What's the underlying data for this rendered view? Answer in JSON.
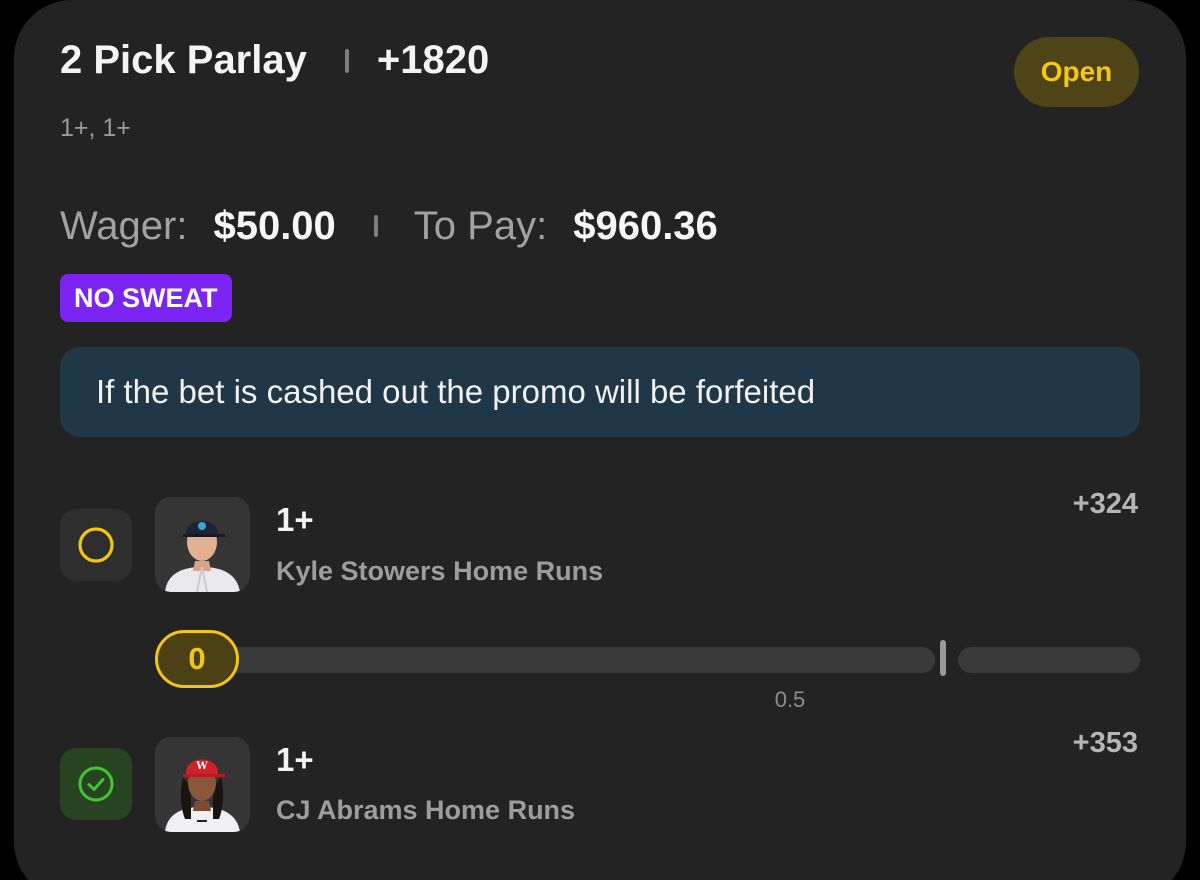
{
  "bet": {
    "title": "2 Pick Parlay",
    "odds": "+1820",
    "status": "Open",
    "subtitle": "1+, 1+",
    "wager_label": "Wager:",
    "wager_value": "$50.00",
    "topay_label": "To Pay:",
    "topay_value": "$960.36",
    "promo_badge": "NO SWEAT",
    "notice": "If the bet is cashed out the promo will be forfeited"
  },
  "picks": [
    {
      "line": "1+",
      "market": "Kyle Stowers Home Runs",
      "odds": "+324",
      "status": "pending",
      "progress": {
        "current": "0",
        "threshold": "0.5"
      }
    },
    {
      "line": "1+",
      "market": "CJ Abrams Home Runs",
      "odds": "+353",
      "status": "won"
    }
  ],
  "colors": {
    "open_accent": "#f3c713",
    "promo_purple": "#7c24f2",
    "notice_bg": "#1f3747",
    "won_green": "#48c23a"
  },
  "icons": {
    "pending": "circle-outline-icon",
    "won": "check-circle-icon"
  }
}
